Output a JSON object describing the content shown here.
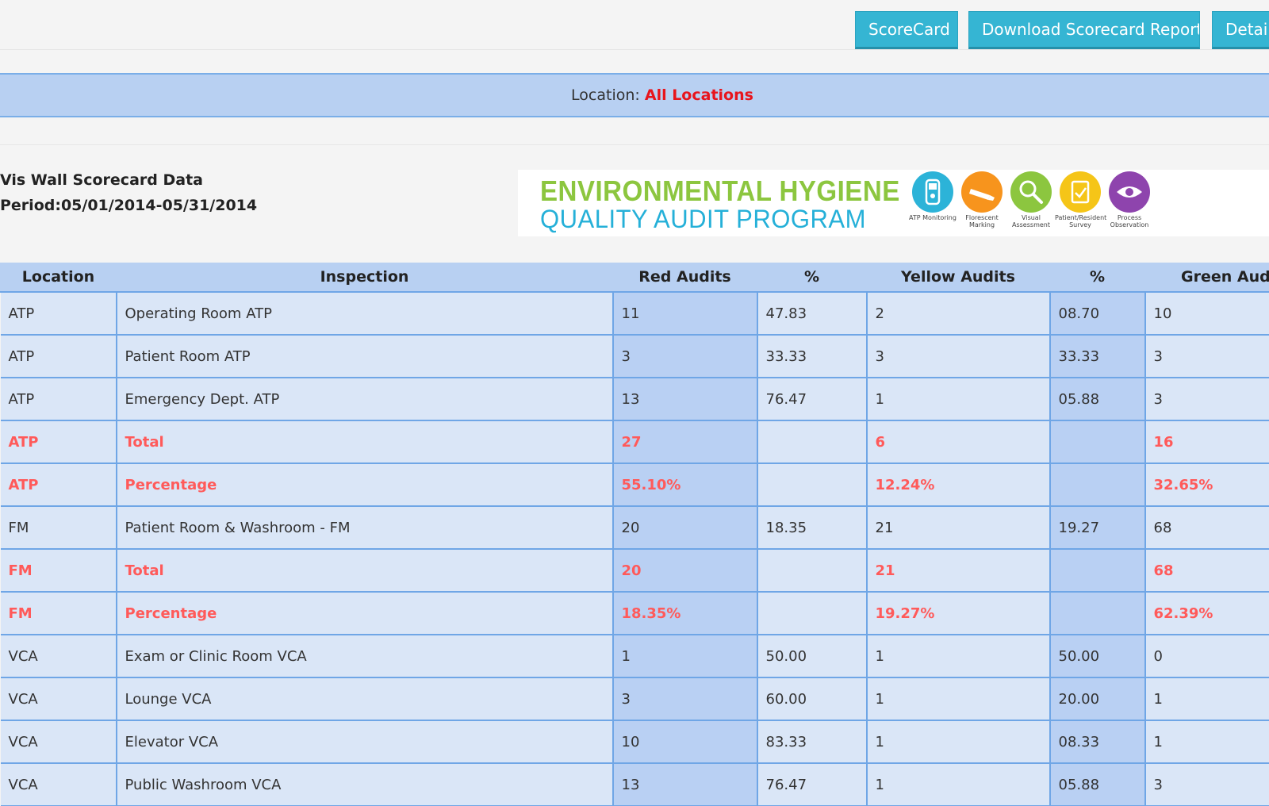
{
  "toolbar": {
    "scorecard_label": "ScoreCard",
    "download_label": "Download Scorecard Report",
    "detail_label": "Detail"
  },
  "location": {
    "label": "Location:",
    "value": "All Locations"
  },
  "info": {
    "title": "Vis Wall Scorecard Data",
    "period": "Period:05/01/2014-05/31/2014"
  },
  "banner": {
    "line1": "ENVIRONMENTAL HYGIENE",
    "line2": "QUALITY AUDIT PROGRAM",
    "programs": [
      {
        "label": "ATP Monitoring",
        "color": "#2cb3d8",
        "icon": "atp-meter-icon"
      },
      {
        "label": "Florescent Marking",
        "color": "#f7941d",
        "icon": "marker-icon"
      },
      {
        "label": "Visual Assessment",
        "color": "#8cc63f",
        "icon": "magnifier-icon"
      },
      {
        "label": "Patient/Resident Survey",
        "color": "#f5c518",
        "icon": "clipboard-icon"
      },
      {
        "label": "Process Observation",
        "color": "#8e44ad",
        "icon": "eye-icon"
      }
    ]
  },
  "table": {
    "headers": [
      "Location",
      "Inspection",
      "Red Audits",
      "%",
      "Yellow Audits",
      "%",
      "Green Audits"
    ],
    "rows": [
      {
        "type": "data",
        "cells": [
          "ATP",
          "Operating Room ATP",
          "11",
          "47.83",
          "2",
          "08.70",
          "10"
        ]
      },
      {
        "type": "data",
        "cells": [
          "ATP",
          "Patient Room ATP",
          "3",
          "33.33",
          "3",
          "33.33",
          "3"
        ]
      },
      {
        "type": "data",
        "cells": [
          "ATP",
          "Emergency Dept. ATP",
          "13",
          "76.47",
          "1",
          "05.88",
          "3"
        ]
      },
      {
        "type": "summary",
        "cells": [
          "ATP",
          "Total",
          "27",
          "",
          "6",
          "",
          "16"
        ]
      },
      {
        "type": "summary",
        "cells": [
          "ATP",
          "Percentage",
          "55.10%",
          "",
          "12.24%",
          "",
          "32.65%"
        ]
      },
      {
        "type": "data",
        "cells": [
          "FM",
          "Patient Room & Washroom - FM",
          "20",
          "18.35",
          "21",
          "19.27",
          "68"
        ]
      },
      {
        "type": "summary",
        "cells": [
          "FM",
          "Total",
          "20",
          "",
          "21",
          "",
          "68"
        ]
      },
      {
        "type": "summary",
        "cells": [
          "FM",
          "Percentage",
          "18.35%",
          "",
          "19.27%",
          "",
          "62.39%"
        ]
      },
      {
        "type": "data",
        "cells": [
          "VCA",
          "Exam or Clinic Room VCA",
          "1",
          "50.00",
          "1",
          "50.00",
          "0"
        ]
      },
      {
        "type": "data",
        "cells": [
          "VCA",
          "Lounge VCA",
          "3",
          "60.00",
          "1",
          "20.00",
          "1"
        ]
      },
      {
        "type": "data",
        "cells": [
          "VCA",
          "Elevator VCA",
          "10",
          "83.33",
          "1",
          "08.33",
          "1"
        ]
      },
      {
        "type": "data",
        "cells": [
          "VCA",
          "Public Washroom VCA",
          "13",
          "76.47",
          "1",
          "05.88",
          "3"
        ]
      }
    ]
  },
  "colors": {
    "button": "#35b5d3",
    "header_band": "#b8d0f2",
    "summary_text": "#ff5a5a",
    "location_value": "#e8141c"
  }
}
